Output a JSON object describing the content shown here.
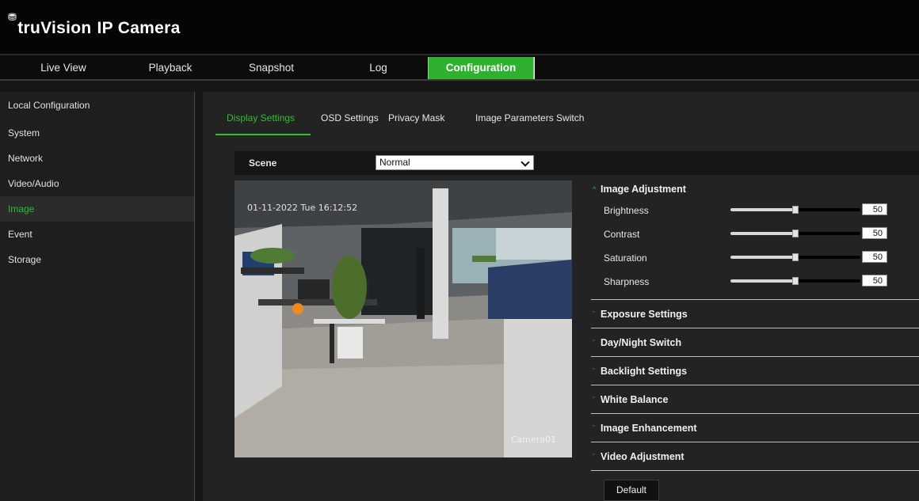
{
  "app": {
    "logo_mark": "⛃",
    "brand_word": "truVision",
    "brand_suffix": "IP Camera"
  },
  "nav": {
    "tabs": [
      {
        "label": "Live View"
      },
      {
        "label": "Playback"
      },
      {
        "label": "Snapshot"
      },
      {
        "label": "Log"
      },
      {
        "label": "Configuration",
        "active": true
      }
    ]
  },
  "sidebar": {
    "items": [
      {
        "label": "Local Configuration"
      },
      {
        "label": "System"
      },
      {
        "label": "Network"
      },
      {
        "label": "Video/Audio"
      },
      {
        "label": "Image",
        "active": true
      },
      {
        "label": "Event"
      },
      {
        "label": "Storage"
      }
    ]
  },
  "subtabs": [
    {
      "label": "Display Settings",
      "active": true
    },
    {
      "label": "OSD Settings"
    },
    {
      "label": "Privacy Mask"
    },
    {
      "label": "Image Parameters Switch"
    }
  ],
  "scene": {
    "label": "Scene",
    "value": "Normal"
  },
  "video": {
    "osd_time": "01-11-2022 Tue 16:12:52",
    "osd_name": "Camera01"
  },
  "image_adjustment": {
    "title": "Image Adjustment",
    "sliders": [
      {
        "label": "Brightness",
        "value": "50",
        "level": 0.5
      },
      {
        "label": "Contrast",
        "value": "50",
        "level": 0.5
      },
      {
        "label": "Saturation",
        "value": "50",
        "level": 0.5
      },
      {
        "label": "Sharpness",
        "value": "50",
        "level": 0.5
      }
    ]
  },
  "sections": [
    {
      "label": "Exposure Settings"
    },
    {
      "label": "Day/Night Switch"
    },
    {
      "label": "Backlight Settings"
    },
    {
      "label": "White Balance"
    },
    {
      "label": "Image Enhancement"
    },
    {
      "label": "Video Adjustment"
    }
  ],
  "caret_open": "^",
  "caret_closed": "ˇ",
  "default_button": "Default",
  "colors": {
    "accent": "#2fb12f",
    "header": "#050505",
    "panel": "#232323"
  }
}
